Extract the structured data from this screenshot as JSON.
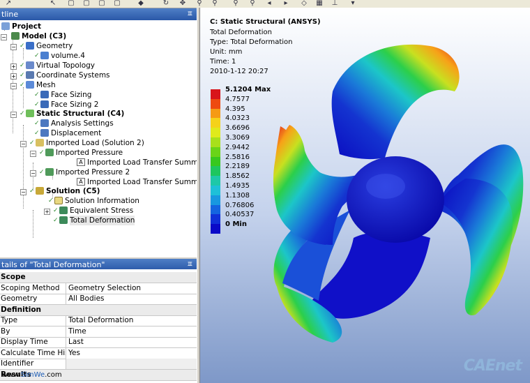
{
  "outline": {
    "header": "tline",
    "tree": [
      {
        "label": "Project",
        "bold": true
      },
      {
        "label": "Model (C3)",
        "bold": true
      },
      {
        "label": "Geometry"
      },
      {
        "label": "volume.4"
      },
      {
        "label": "Virtual Topology"
      },
      {
        "label": "Coordinate Systems"
      },
      {
        "label": "Mesh"
      },
      {
        "label": "Face Sizing"
      },
      {
        "label": "Face Sizing 2"
      },
      {
        "label": "Static Structural (C4)",
        "bold": true
      },
      {
        "label": "Analysis Settings"
      },
      {
        "label": "Displacement"
      },
      {
        "label": "Imported Load (Solution 2)"
      },
      {
        "label": "Imported Pressure"
      },
      {
        "label": "Imported Load Transfer Summary"
      },
      {
        "label": "Imported Pressure 2"
      },
      {
        "label": "Imported Load Transfer Summary"
      },
      {
        "label": "Solution (C5)",
        "bold": true
      },
      {
        "label": "Solution Information"
      },
      {
        "label": "Equivalent Stress"
      },
      {
        "label": "Total Deformation"
      }
    ]
  },
  "details": {
    "header": "tails of \"Total Deformation\"",
    "rows": [
      {
        "k": "Scope",
        "v": "",
        "group": true
      },
      {
        "k": "Scoping Method",
        "v": "Geometry Selection"
      },
      {
        "k": "Geometry",
        "v": "All Bodies"
      },
      {
        "k": "Definition",
        "v": "",
        "group": true
      },
      {
        "k": "Type",
        "v": "Total Deformation"
      },
      {
        "k": "By",
        "v": "Time"
      },
      {
        "k": "Display Time",
        "v": "Last"
      },
      {
        "k": "Calculate Time History",
        "v": "Yes"
      },
      {
        "k": "Identifier",
        "v": ""
      },
      {
        "k": "Results",
        "v": "",
        "group": true
      }
    ]
  },
  "viewport": {
    "title": "C: Static Structural (ANSYS)",
    "result": "Total Deformation",
    "type_line": "Type: Total Deformation",
    "unit": "Unit: mm",
    "time": "Time: 1",
    "date": "2010-1-12 20:27",
    "legend": [
      {
        "label": "5.1204 Max",
        "color": "#d8141a"
      },
      {
        "label": "4.7577",
        "color": "#ee4a10"
      },
      {
        "label": "4.395",
        "color": "#f59a14"
      },
      {
        "label": "4.0323",
        "color": "#f5d21a"
      },
      {
        "label": "3.6696",
        "color": "#e0ea1c"
      },
      {
        "label": "3.3069",
        "color": "#a8e01c"
      },
      {
        "label": "2.9442",
        "color": "#6ad418"
      },
      {
        "label": "2.5816",
        "color": "#38c81e"
      },
      {
        "label": "2.2189",
        "color": "#1ec65e"
      },
      {
        "label": "1.8562",
        "color": "#1ec8a8"
      },
      {
        "label": "1.4935",
        "color": "#1ec0d8"
      },
      {
        "label": "1.1308",
        "color": "#1898e0"
      },
      {
        "label": "0.76806",
        "color": "#1464e0"
      },
      {
        "label": "0.40537",
        "color": "#1030d8"
      },
      {
        "label": "0 Min",
        "color": "#0a0ac8"
      }
    ]
  },
  "watermark": {
    "prefix": "www.",
    "site": "SimWe",
    ".com": ".com",
    "logo": "CAEnet"
  }
}
